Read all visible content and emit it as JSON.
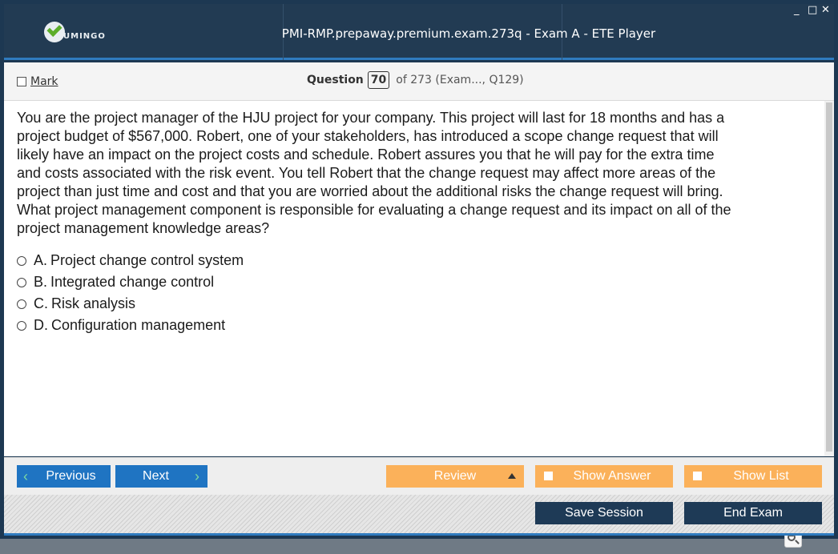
{
  "app": {
    "logo_text": "UMINGO",
    "window_title": "PMI-RMP.prepaway.premium.exam.273q - Exam A - ETE Player",
    "controls": {
      "minimize": "_",
      "maximize": "□",
      "close": "✕"
    }
  },
  "question_bar": {
    "mark_label": "Mark",
    "question_label": "Question",
    "question_number": "70",
    "of_text": "of 273 (Exam..., Q129)"
  },
  "question": {
    "lines": [
      "You are the project manager of the HJU project for your company. This project will last for 18 months and has a",
      "project budget of $567,000. Robert, one of your stakeholders, has introduced a scope change request that will",
      "likely have an impact on the project costs and schedule. Robert assures you that he will pay for the extra time",
      "and costs associated with the risk event. You tell Robert that the change request may affect more areas of the",
      "project than just time and cost and that you are worried about the additional risks the change request will bring.",
      "What project management component is responsible for evaluating a change request and its impact on all of the",
      "project management knowledge areas?"
    ],
    "choices": [
      {
        "letter": "A.",
        "text": "Project change control system"
      },
      {
        "letter": "B.",
        "text": "Integrated change control"
      },
      {
        "letter": "C.",
        "text": "Risk analysis"
      },
      {
        "letter": "D.",
        "text": "Configuration management"
      }
    ]
  },
  "zoom": {
    "icons": [
      "search-icon",
      "zoom-in-icon",
      "zoom-out-icon"
    ]
  },
  "nav": {
    "previous": "Previous",
    "next": "Next",
    "review": "Review",
    "show_answer": "Show Answer",
    "show_list": "Show List"
  },
  "footer": {
    "save_session": "Save Session",
    "end_exam": "End Exam"
  },
  "colors": {
    "titlebar": "#223b53",
    "accent_blue": "#1f74c2",
    "accent_orange": "#fbb15a",
    "dark_button": "#1e3a56",
    "logo_green": "#5cae2a"
  }
}
